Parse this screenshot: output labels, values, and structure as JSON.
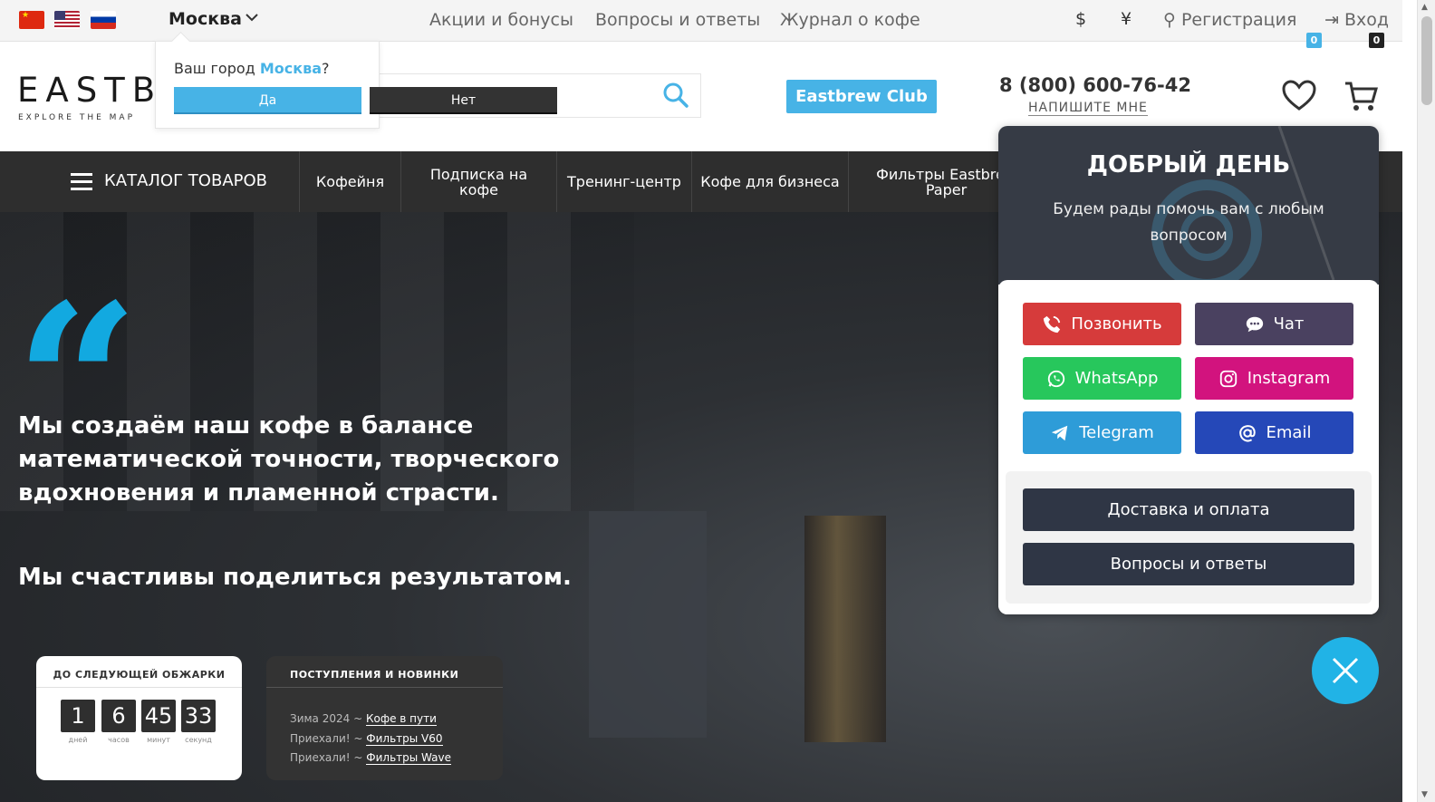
{
  "topbar": {
    "city": "Москва",
    "links": [
      "Акции и бонусы",
      "Вопросы и ответы",
      "Журнал о кофе"
    ],
    "currencies": [
      "$",
      "¥"
    ],
    "register": "Регистрация",
    "login": "Вход"
  },
  "header": {
    "logo": "EASTBREW",
    "logo_tagline": "EXPLORE THE MAP",
    "club_button": "Eastbrew Club",
    "phone": "8 (800) 600-76-42",
    "write_me": "НАПИШИТЕ МНЕ",
    "favorites_count": "0",
    "cart_count": "0"
  },
  "city_popup": {
    "question_prefix": "Ваш город",
    "city": "Москва",
    "question_suffix": "?",
    "yes": "Да",
    "no": "Нет"
  },
  "nav": {
    "catalog": "КАТАЛОГ ТОВАРОВ",
    "items": [
      "Кофейня",
      "Подписка на кофе",
      "Тренинг-центр",
      "Кофе для бизнеса",
      "Фильтры Eastbrew Paper"
    ]
  },
  "hero": {
    "quote_mark": "“",
    "text": "Мы создаём наш кофе в балансе математической точности, творческого вдохновения и пламенной страсти.",
    "text2": "Мы счастливы поделиться результатом."
  },
  "roast": {
    "title": "ДО СЛЕДУЮЩЕЙ ОБЖАРКИ",
    "values": [
      "1",
      "6",
      "45",
      "33"
    ],
    "labels": [
      "дней",
      "часов",
      "минут",
      "секунд"
    ]
  },
  "news": {
    "title": "ПОСТУПЛЕНИЯ И НОВИНКИ",
    "items": [
      {
        "prefix": "Зима 2024 ~",
        "link": "Кофе в пути"
      },
      {
        "prefix": "Приехали! ~",
        "link": "Фильтры V60"
      },
      {
        "prefix": "Приехали! ~",
        "link": "Фильтры Wave"
      }
    ]
  },
  "widget": {
    "greeting": "ДОБРЫЙ ДЕНЬ",
    "subtitle": "Будем рады помочь вам с любым вопросом",
    "buttons": {
      "call": "Позвонить",
      "chat": "Чат",
      "whatsapp": "WhatsApp",
      "instagram": "Instagram",
      "telegram": "Telegram",
      "email": "Email"
    },
    "links": [
      "Доставка и оплата",
      "Вопросы и ответы"
    ]
  },
  "colors": {
    "accent": "#47b3e6",
    "nav_bg": "#2e2e2e",
    "call": "#d63b3b",
    "chat": "#4a4160",
    "whatsapp": "#27c75c",
    "instagram": "#d2137e",
    "telegram": "#2e9cd8",
    "email": "#2548b8"
  }
}
